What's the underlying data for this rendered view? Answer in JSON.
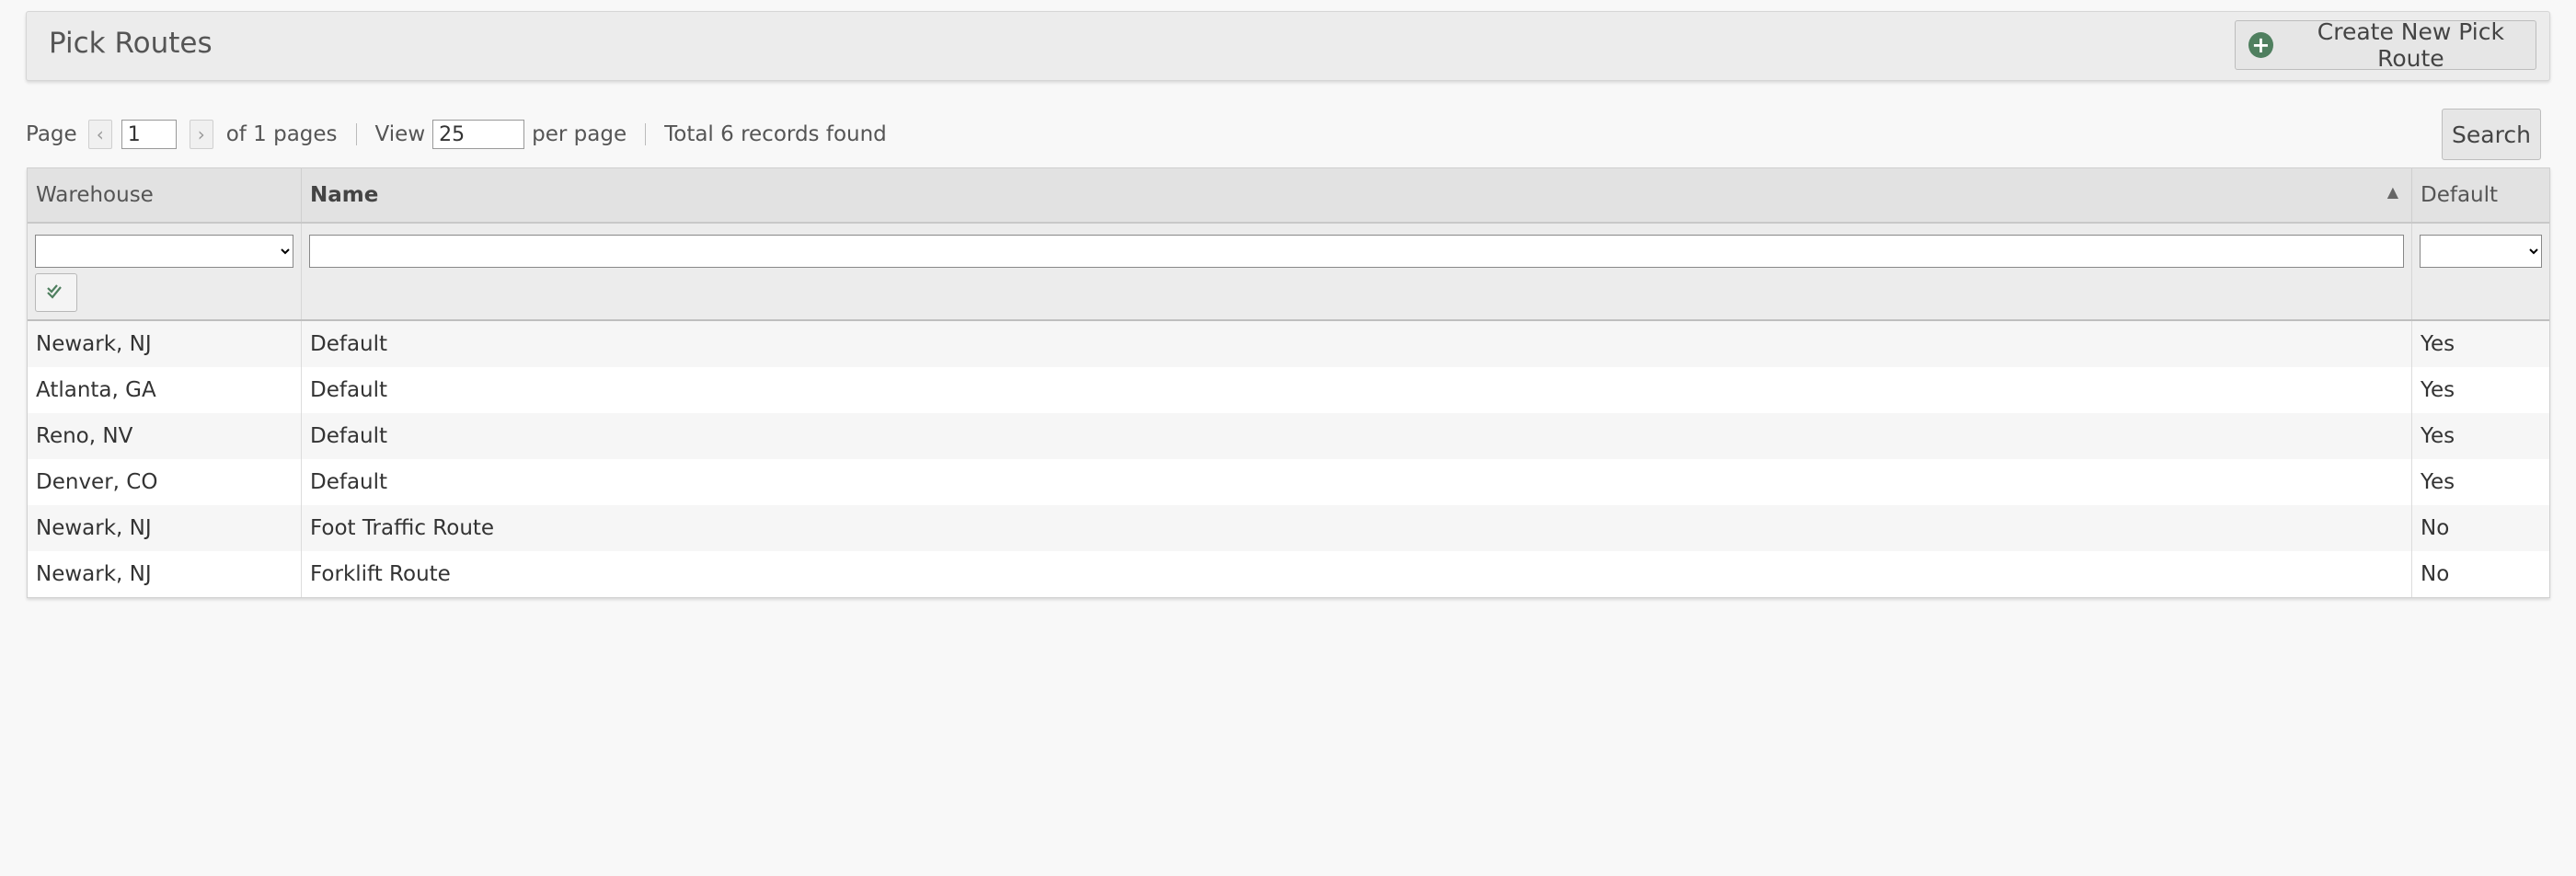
{
  "header": {
    "title": "Pick Routes",
    "create_label": "Create New Pick Route",
    "create_icon": "plus-circle-icon"
  },
  "pager": {
    "page_label": "Page",
    "current_page": "1",
    "of_pages": "of 1 pages",
    "view_label": "View",
    "per_page_value": "25",
    "per_page_label": "per page",
    "total_text": "Total 6 records found",
    "search_label": "Search"
  },
  "grid": {
    "columns": [
      {
        "label": "Warehouse"
      },
      {
        "label": "Name",
        "sorted": "ascending"
      },
      {
        "label": "Default"
      }
    ],
    "filters": {
      "warehouse_value": "",
      "name_value": "",
      "default_value": ""
    },
    "rows": [
      {
        "warehouse": "Newark, NJ",
        "name": "Default",
        "default": "Yes"
      },
      {
        "warehouse": "Atlanta, GA",
        "name": "Default",
        "default": "Yes"
      },
      {
        "warehouse": "Reno, NV",
        "name": "Default",
        "default": "Yes"
      },
      {
        "warehouse": "Denver, CO",
        "name": "Default",
        "default": "Yes"
      },
      {
        "warehouse": "Newark, NJ",
        "name": "Foot Traffic Route",
        "default": "No"
      },
      {
        "warehouse": "Newark, NJ",
        "name": "Forklift Route",
        "default": "No"
      }
    ]
  },
  "colors": {
    "accent": "#4f7f5f",
    "header_bg": "#ececec"
  }
}
